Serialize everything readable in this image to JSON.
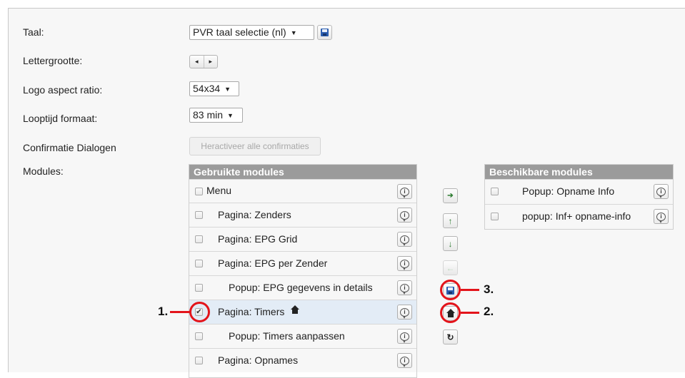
{
  "settings": {
    "taal_label": "Taal:",
    "taal_value": "PVR taal selectie (nl)",
    "lettergrootte_label": "Lettergrootte:",
    "stepper_left": "◂",
    "stepper_right": "▸",
    "logo_label": "Logo aspect ratio:",
    "logo_value": "54x34",
    "looptijd_label": "Looptijd formaat:",
    "looptijd_value": "83 min",
    "confirm_label": "Confirmatie Dialogen",
    "confirm_button": "Heractiveer alle confirmaties",
    "modules_label": "Modules:"
  },
  "used_modules": {
    "header": "Gebruikte modules",
    "rows": [
      {
        "label": "Menu",
        "checked": false
      },
      {
        "label": "Pagina: Zenders",
        "checked": false
      },
      {
        "label": "Pagina: EPG Grid",
        "checked": false
      },
      {
        "label": "Pagina: EPG per Zender",
        "checked": false
      },
      {
        "label": "Popup: EPG gegevens in details",
        "checked": false
      },
      {
        "label": "Pagina: Timers",
        "checked": true
      },
      {
        "label": "Popup: Timers aanpassen",
        "checked": false
      },
      {
        "label": "Pagina: Opnames",
        "checked": false
      }
    ]
  },
  "available_modules": {
    "header": "Beschikbare modules",
    "rows": [
      {
        "label": "Popup: Opname Info",
        "checked": false
      },
      {
        "label": "popup: Inf+ opname-info",
        "checked": false
      }
    ]
  },
  "controls": {
    "add": "➔",
    "up": "↑",
    "down": "↓",
    "remove": "←",
    "reset": "↻"
  },
  "annotations": {
    "one": "1.",
    "two": "2.",
    "three": "3."
  },
  "colors": {
    "annotation_red": "#e3141b",
    "header_gray": "#9b9b9b",
    "arrow_green": "#2e7d32"
  }
}
